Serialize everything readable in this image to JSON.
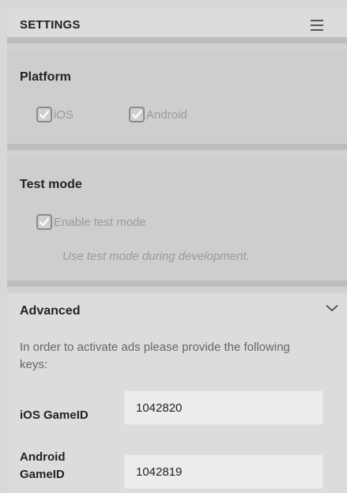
{
  "header": {
    "title": "SETTINGS",
    "menu_icon": "hamburger-menu-icon"
  },
  "platform": {
    "title": "Platform",
    "options": [
      {
        "label": "iOS",
        "checked": true
      },
      {
        "label": "Android",
        "checked": true
      }
    ]
  },
  "test_mode": {
    "title": "Test mode",
    "checkbox_label": "Enable test mode",
    "checked": true,
    "hint": "Use test mode during development."
  },
  "advanced": {
    "title": "Advanced",
    "expanded": true,
    "description": "In order to activate ads please provide the following keys:",
    "fields": [
      {
        "label": "iOS GameID",
        "value": "1042820"
      },
      {
        "label_line1": "Android",
        "label_line2": "GameID",
        "value": "1042819"
      }
    ]
  },
  "colors": {
    "panel_bg": "#d2d2d2",
    "divider": "#bdbdbd",
    "disabled_text": "#9a9a9a",
    "input_bg": "#ececec"
  }
}
